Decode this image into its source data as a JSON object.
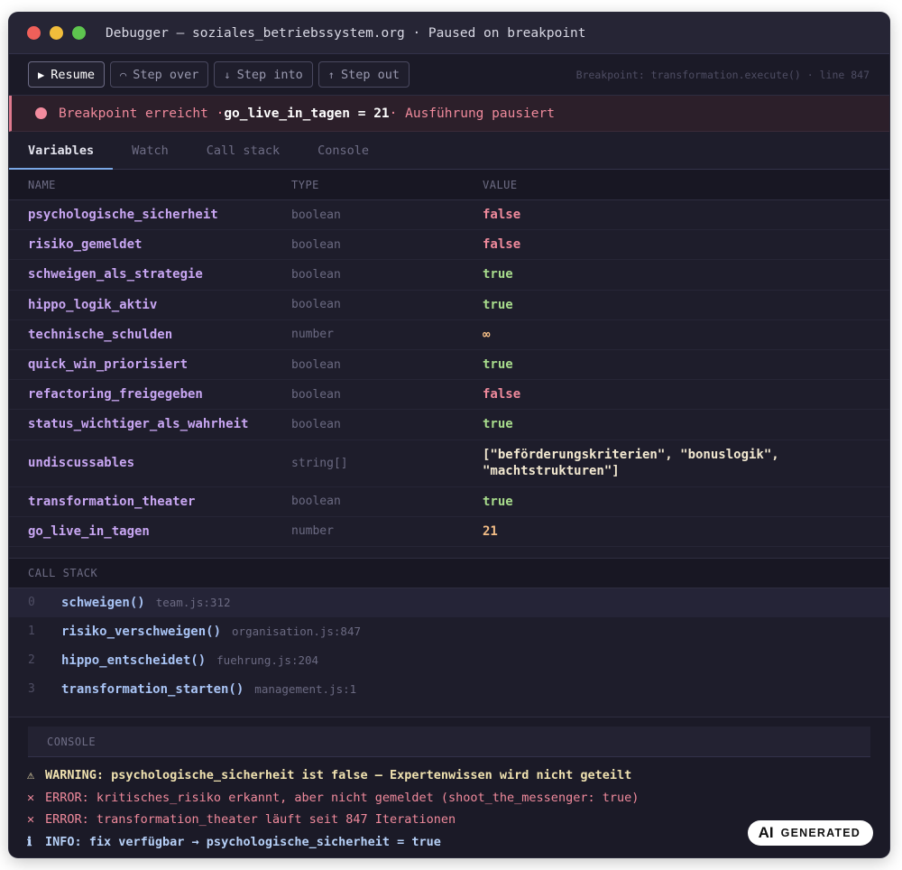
{
  "window": {
    "title": "Debugger — soziales_betriebssystem.org · Paused on breakpoint"
  },
  "toolbar": {
    "resume_label": "Resume",
    "step_over_label": "Step over",
    "step_into_label": "Step into",
    "step_out_label": "Step out",
    "breakpoint_info": "Breakpoint: transformation.execute() · line 847"
  },
  "banner": {
    "prefix": "Breakpoint erreicht · ",
    "emphasis": "go_live_in_tagen = 21",
    "suffix": " · Ausführung pausiert"
  },
  "tabs": [
    {
      "label": "Variables",
      "active": true
    },
    {
      "label": "Watch",
      "active": false
    },
    {
      "label": "Call stack",
      "active": false
    },
    {
      "label": "Console",
      "active": false
    }
  ],
  "variables": {
    "headers": {
      "name": "NAME",
      "type": "TYPE",
      "value": "VALUE"
    },
    "rows": [
      {
        "name": "psychologische_sicherheit",
        "type": "boolean",
        "value": "false"
      },
      {
        "name": "risiko_gemeldet",
        "type": "boolean",
        "value": "false"
      },
      {
        "name": "schweigen_als_strategie",
        "type": "boolean",
        "value": "true"
      },
      {
        "name": "hippo_logik_aktiv",
        "type": "boolean",
        "value": "true"
      },
      {
        "name": "technische_schulden",
        "type": "number",
        "value": "∞"
      },
      {
        "name": "quick_win_priorisiert",
        "type": "boolean",
        "value": "true"
      },
      {
        "name": "refactoring_freigegeben",
        "type": "boolean",
        "value": "false"
      },
      {
        "name": "status_wichtiger_als_wahrheit",
        "type": "boolean",
        "value": "true"
      },
      {
        "name": "undiscussables",
        "type": "string[]",
        "value": "[\"beförderungskriterien\", \"bonuslogik\", \"machtstrukturen\"]"
      },
      {
        "name": "transformation_theater",
        "type": "boolean",
        "value": "true"
      },
      {
        "name": "go_live_in_tagen",
        "type": "number",
        "value": "21"
      }
    ]
  },
  "call_stack": {
    "header": "CALL STACK",
    "frames": [
      {
        "index": "0",
        "fn": "schweigen()",
        "file": "team.js:312"
      },
      {
        "index": "1",
        "fn": "risiko_verschweigen()",
        "file": "organisation.js:847"
      },
      {
        "index": "2",
        "fn": "hippo_entscheidet()",
        "file": "fuehrung.js:204"
      },
      {
        "index": "3",
        "fn": "transformation_starten()",
        "file": "management.js:1"
      }
    ]
  },
  "console": {
    "header": "CONSOLE",
    "lines": [
      {
        "level": "warn",
        "icon": "⚠",
        "text": "WARNING: psychologische_sicherheit ist false — Expertenwissen wird nicht geteilt"
      },
      {
        "level": "err",
        "icon": "✕",
        "text": "ERROR: kritisches_risiko erkannt, aber nicht gemeldet (shoot_the_messenger: true)"
      },
      {
        "level": "err",
        "icon": "✕",
        "text": "ERROR: transformation_theater läuft seit 847 Iterationen"
      },
      {
        "level": "info",
        "icon": "ℹ",
        "text": "INFO: fix verfügbar → psychologische_sicherheit = true"
      }
    ]
  },
  "badge": {
    "ai": "AI",
    "label": "GENERATED"
  }
}
